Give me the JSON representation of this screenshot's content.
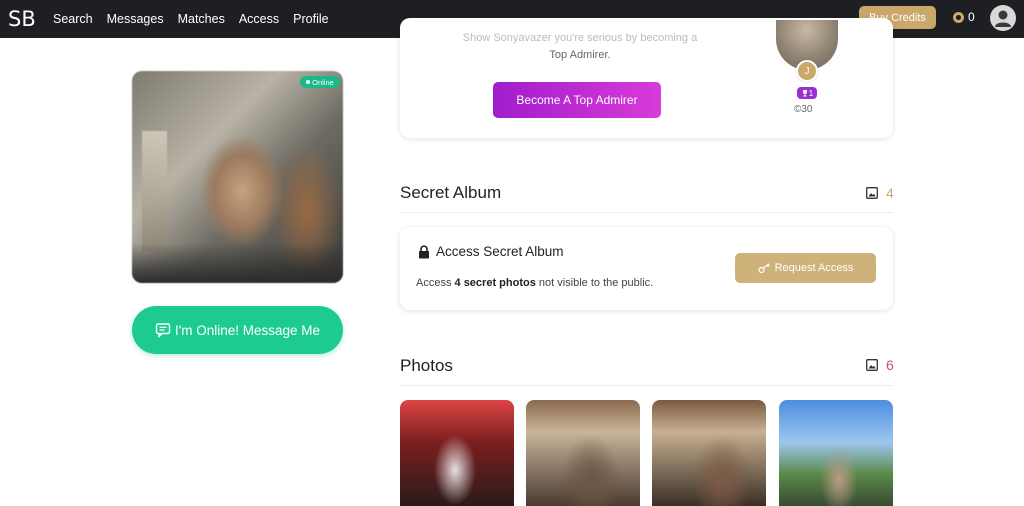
{
  "nav": {
    "logo": "SB",
    "items": [
      {
        "label": "Search"
      },
      {
        "label": "Messages"
      },
      {
        "label": "Matches"
      },
      {
        "label": "Access"
      },
      {
        "label": "Profile"
      }
    ],
    "buy_credits": "Buy Credits",
    "credits_count": "0"
  },
  "profile": {
    "online_badge": "Online",
    "message_button": "I'm Online! Message Me"
  },
  "top_admirer": {
    "text_line1": "Show Sonyavazer you're serious by becoming a",
    "text_line2": "Top Admirer.",
    "button": "Become A Top Admirer",
    "initial": "J",
    "rank": "1",
    "amount": "30"
  },
  "secret_album": {
    "title": "Secret Album",
    "count": "4",
    "card_title": "Access Secret Album",
    "desc_prefix": "Access ",
    "desc_bold": "4 secret photos",
    "desc_suffix": " not visible to the public.",
    "request_button": "Request Access"
  },
  "photos": {
    "title": "Photos",
    "count": "6"
  },
  "colors": {
    "gold": "#c9a86a",
    "green": "#1ecb8f",
    "purple": "#a11dcc",
    "pink_count": "#d4458a"
  }
}
